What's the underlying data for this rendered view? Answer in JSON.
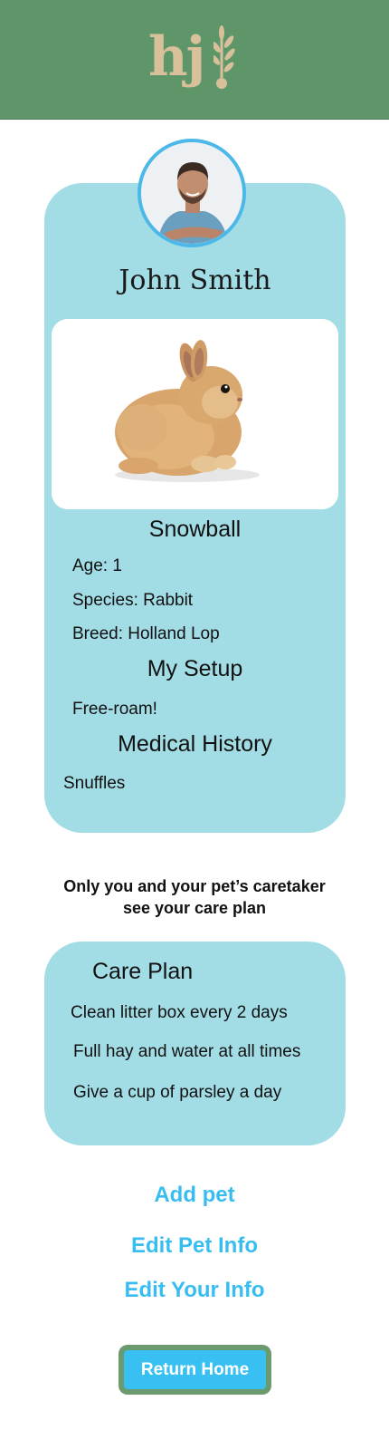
{
  "header": {
    "logo_text": "hj",
    "background_color": "#5e966a",
    "logo_color": "#d8c09a"
  },
  "profile": {
    "owner_name": "John Smith",
    "avatar_icon": "person-avatar-icon",
    "pet_image_icon": "rabbit-photo-icon",
    "pet_name": "Snowball",
    "age": "Age: 1",
    "species": "Species: Rabbit",
    "breed": "Breed: Holland Lop",
    "setup_heading": "My Setup",
    "setup_text": "Free-roam!",
    "medical_heading": "Medical History",
    "medical_text": "Snuffles",
    "card_color": "#a2dde6"
  },
  "privacy_note": {
    "line1": "Only you and your pet’s caretaker",
    "line2": "see your care plan"
  },
  "care_plan": {
    "heading": "Care Plan",
    "items": [
      "Clean litter box every 2 days",
      "Full hay and water at all times",
      "Give a cup of parsley a day"
    ]
  },
  "actions": {
    "add_pet": "Add pet",
    "edit_pet_info": "Edit Pet Info",
    "edit_your_info": "Edit Your Info",
    "link_color": "#38bdf0",
    "return_home": "Return Home"
  }
}
